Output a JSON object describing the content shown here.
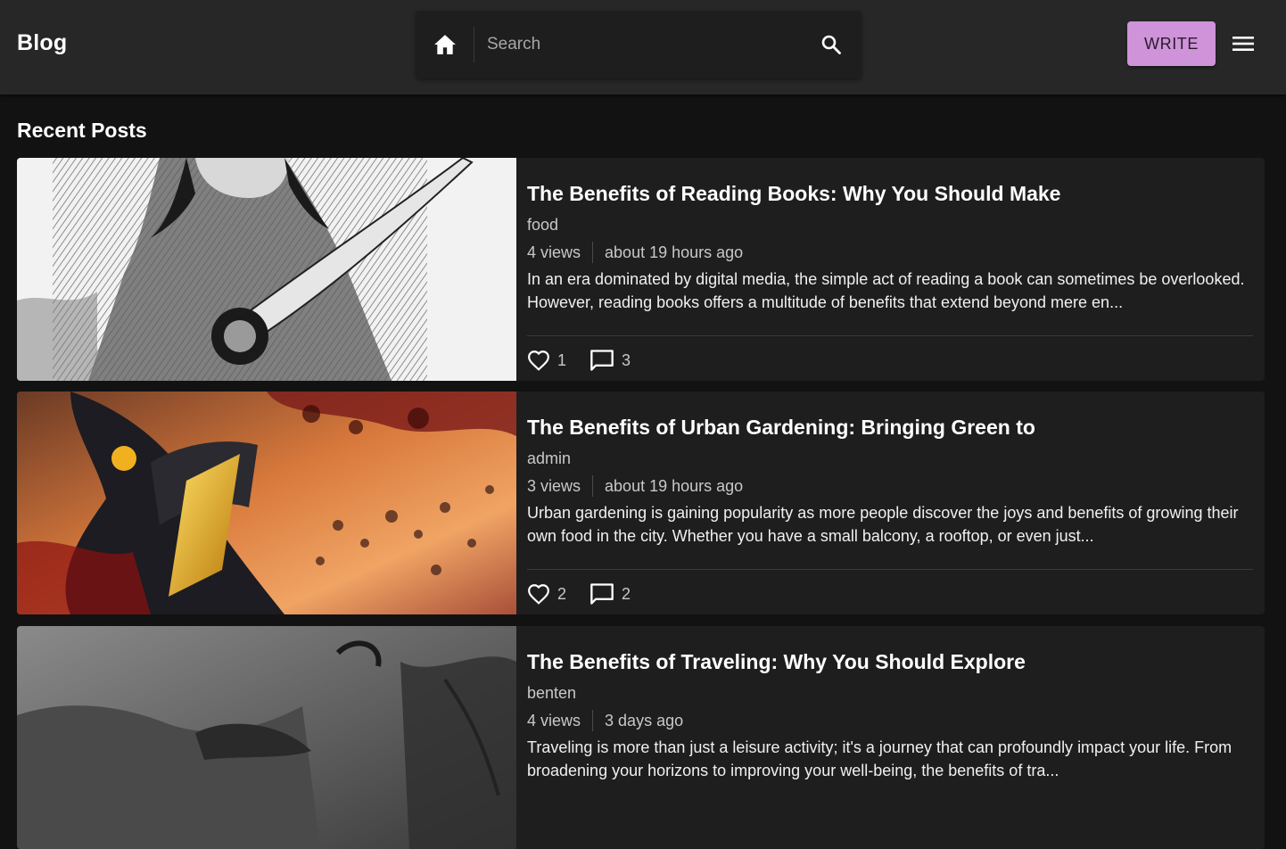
{
  "header": {
    "brand": "Blog",
    "search_placeholder": "Search",
    "write_label": "WRITE"
  },
  "main": {
    "section_title": "Recent Posts",
    "posts": [
      {
        "title": "The Benefits of Reading Books: Why You Should Make",
        "author": "food",
        "views": "4 views",
        "time": "about 19 hours ago",
        "excerpt": "In an era dominated by digital media, the simple act of reading a book can sometimes be overlooked. However, reading books offers a multitude of benefits that extend beyond mere en...",
        "likes": "1",
        "comments": "3"
      },
      {
        "title": "The Benefits of Urban Gardening: Bringing Green to",
        "author": "admin",
        "views": "3 views",
        "time": "about 19 hours ago",
        "excerpt": "Urban gardening is gaining popularity as more people discover the joys and benefits of growing their own food in the city. Whether you have a small balcony, a rooftop, or even just...",
        "likes": "2",
        "comments": "2"
      },
      {
        "title": "The Benefits of Traveling: Why You Should Explore",
        "author": "benten",
        "views": "4 views",
        "time": "3 days ago",
        "excerpt": "Traveling is more than just a leisure activity; it's a journey that can profoundly impact your life. From broadening your horizons to improving your well-being, the benefits of tra...",
        "likes": "",
        "comments": ""
      }
    ]
  },
  "icons": {
    "home": "home-icon",
    "search": "search-icon",
    "menu": "menu-icon",
    "like": "heart-outline-icon",
    "comment": "comment-outline-icon"
  },
  "colors": {
    "background": "#121212",
    "appbar": "#272727",
    "card": "#1e1e1e",
    "accent": "#ce93d8"
  }
}
